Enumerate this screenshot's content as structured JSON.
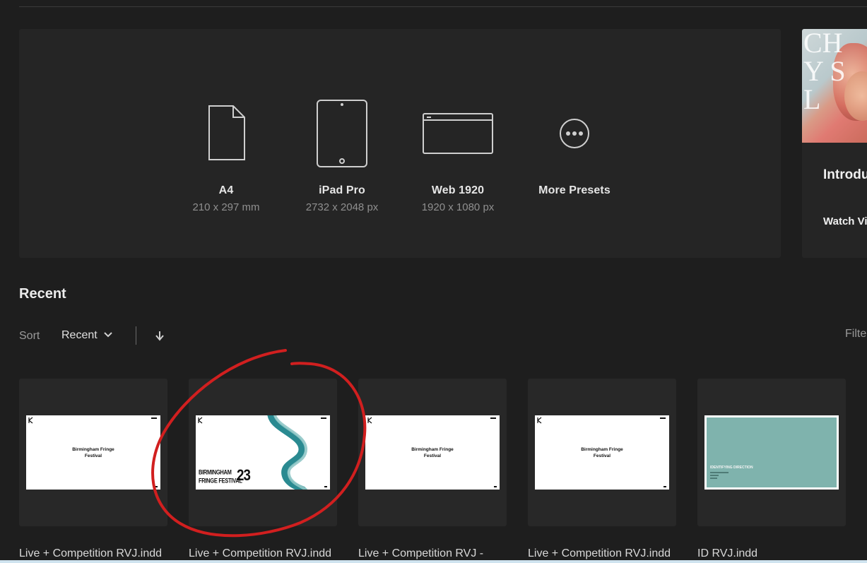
{
  "presets": [
    {
      "name": "A4",
      "size": "210 x 297 mm",
      "icon": "document-icon"
    },
    {
      "name": "iPad Pro",
      "size": "2732 x 2048 px",
      "icon": "tablet-icon"
    },
    {
      "name": "Web 1920",
      "size": "1920 x 1080 px",
      "icon": "browser-window-icon"
    },
    {
      "name": "More Presets",
      "size": "",
      "icon": "more-icon"
    }
  ],
  "tutorial": {
    "title": "Introdu",
    "link": "Watch Vi",
    "thumb_letters": "CH\nY S\nL"
  },
  "recent": {
    "heading": "Recent",
    "sort_label": "Sort",
    "sort_value": "Recent",
    "filter_label": "Filter"
  },
  "files": [
    {
      "name": "Live + Competition RVJ.indd",
      "thumb_title": "Birmingham Fringe\nFestival"
    },
    {
      "name": "Live + Competition RVJ.indd",
      "thumb_title_1": "BIRMINGHAM",
      "thumb_title_2": "FRINGE FESTIVAL",
      "thumb_number": "23"
    },
    {
      "name": "Live + Competition RVJ -",
      "thumb_title": "Birmingham Fringe\nFestival"
    },
    {
      "name": "Live + Competition RVJ.indd",
      "thumb_title": "Birmingham Fringe\nFestival"
    },
    {
      "name": "ID RVJ.indd",
      "thumb_title": "IDENTIFYING DIRECTION"
    }
  ],
  "colors": {
    "background": "#1e1e1e",
    "panel": "#252525",
    "card": "#282828",
    "annotation": "#d11f1f",
    "teal": "#7fb3ad"
  }
}
